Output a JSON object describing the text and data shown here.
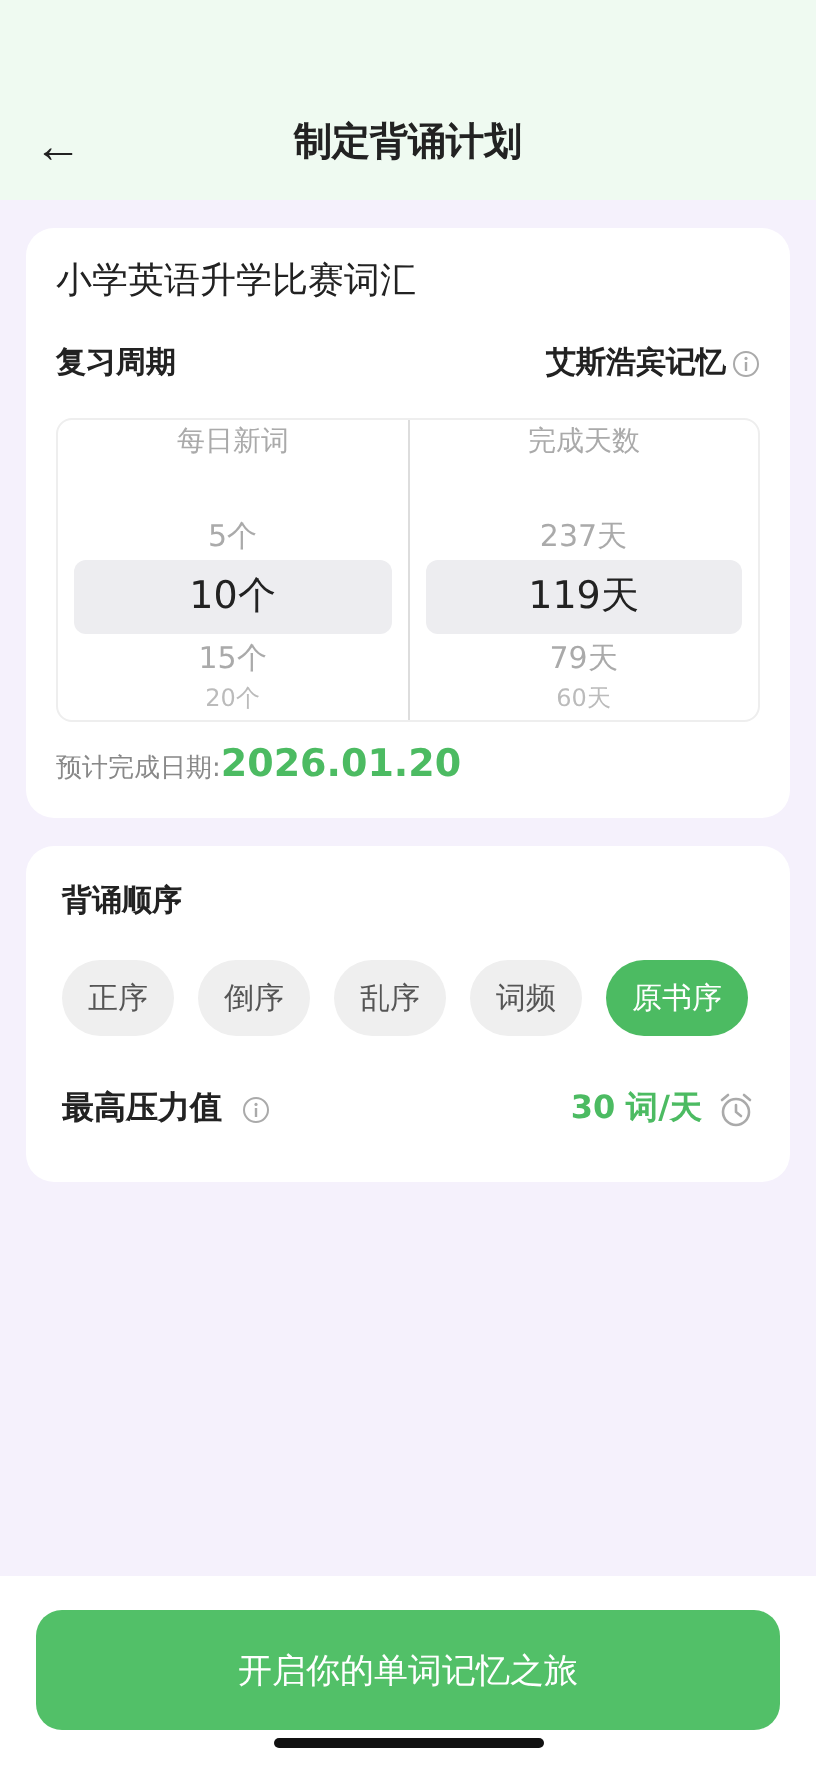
{
  "header": {
    "back": "←",
    "title": "制定背诵计划"
  },
  "plan": {
    "book": "小学英语升学比赛词汇",
    "cycle_label": "复习周期",
    "cycle_value": "艾斯浩宾记忆",
    "pickers": [
      {
        "heading": "每日新词",
        "items": [
          {
            "text": "5个",
            "selected": false
          },
          {
            "text": "10个",
            "selected": true
          },
          {
            "text": "15个",
            "selected": false
          },
          {
            "text": "20个",
            "selected": false
          }
        ]
      },
      {
        "heading": "完成天数",
        "items": [
          {
            "text": "237天",
            "selected": false
          },
          {
            "text": "119天",
            "selected": true
          },
          {
            "text": "79天",
            "selected": false
          },
          {
            "text": "60天",
            "selected": false
          }
        ]
      }
    ],
    "date_label": "预计完成日期:",
    "date_value": "2026.01.20"
  },
  "order": {
    "title": "背诵顺序",
    "options": [
      {
        "label": "正序",
        "selected": false
      },
      {
        "label": "倒序",
        "selected": false
      },
      {
        "label": "乱序",
        "selected": false
      },
      {
        "label": "词频",
        "selected": false
      },
      {
        "label": "原书序",
        "selected": true
      }
    ],
    "pressure_label": "最高压力值",
    "pressure_value": "30 词/天"
  },
  "start_button": "开启你的单词记忆之旅"
}
